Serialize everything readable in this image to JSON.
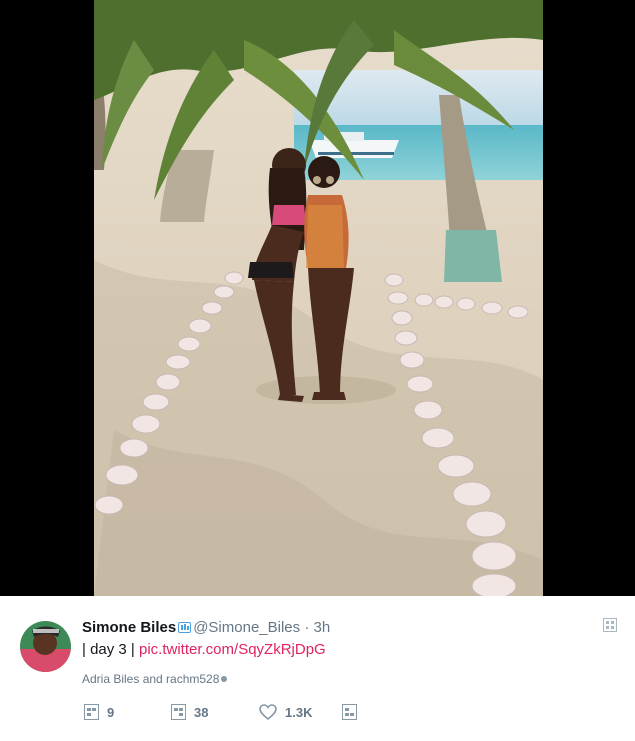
{
  "tweet": {
    "display_name": "Simone Biles",
    "handle": "@Simone_Biles",
    "separator": "·",
    "time": "3h",
    "text_prefix": "| day 3 | ",
    "link_text": "pic.twitter.com/SqyZkRjDpG",
    "liked_by": "Adria Biles and rachm528",
    "replies": "9",
    "retweets": "38",
    "likes": "1.3K"
  },
  "icons": {
    "verified": "verified-badge-icon",
    "reply": "reply-icon",
    "retweet": "retweet-icon",
    "like": "heart-icon",
    "dm": "direct-message-icon",
    "menu": "chevron-down-icon"
  },
  "colors": {
    "link": "#e0245e",
    "muted": "#657786",
    "text": "#14171a",
    "letterbox": "#000000"
  }
}
